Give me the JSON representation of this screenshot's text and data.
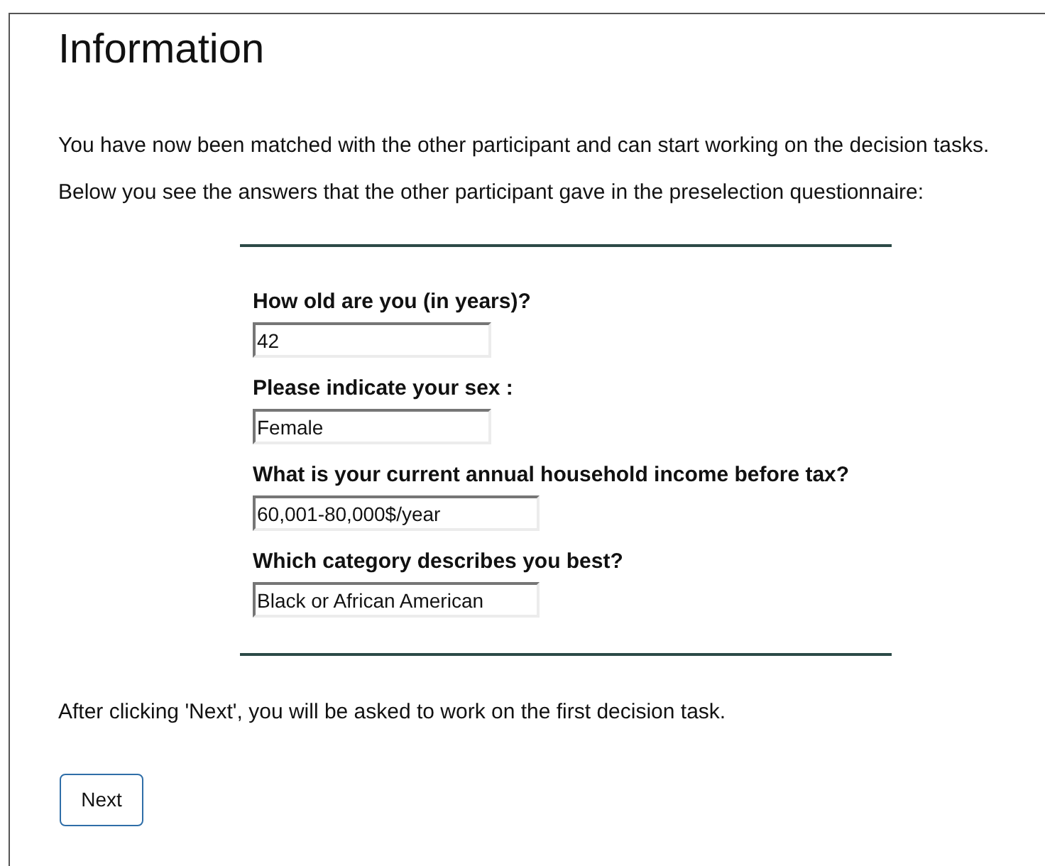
{
  "title": "Information",
  "intro": [
    "You have now been matched with the other participant and can start working on the decision tasks.",
    "Below you see the answers that the other participant gave in the preselection questionnaire:"
  ],
  "questions": [
    {
      "label": "How old are you (in years)?",
      "value": "42"
    },
    {
      "label": "Please indicate your sex :",
      "value": "Female"
    },
    {
      "label": "What is your current annual household income before tax?",
      "value": "60,001-80,000$/year"
    },
    {
      "label": "Which category describes you best?",
      "value": "Black or African American"
    }
  ],
  "note": "After clicking 'Next', you will be asked to work on the first decision task.",
  "next_button": "Next"
}
